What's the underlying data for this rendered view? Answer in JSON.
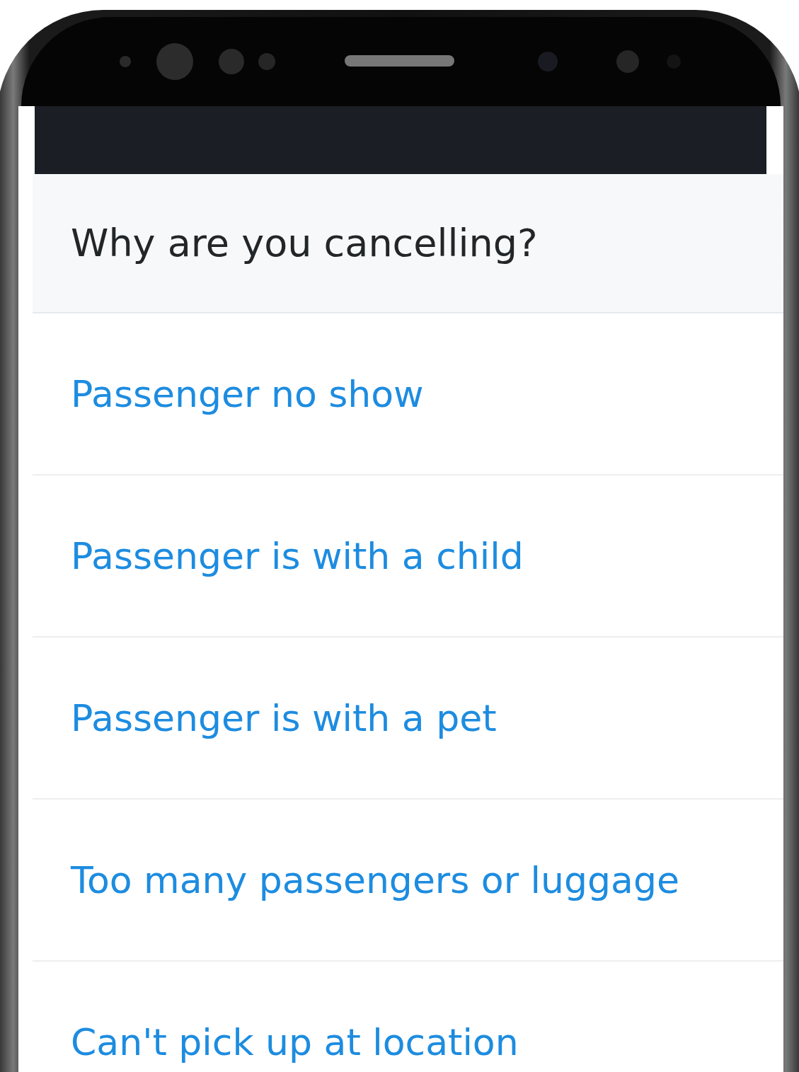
{
  "title": "Why are you cancelling?",
  "reasons": [
    {
      "label": "Passenger no show"
    },
    {
      "label": "Passenger is with a child"
    },
    {
      "label": "Passenger is with a pet"
    },
    {
      "label": "Too many passengers or luggage"
    },
    {
      "label": "Can't pick up at location"
    }
  ]
}
